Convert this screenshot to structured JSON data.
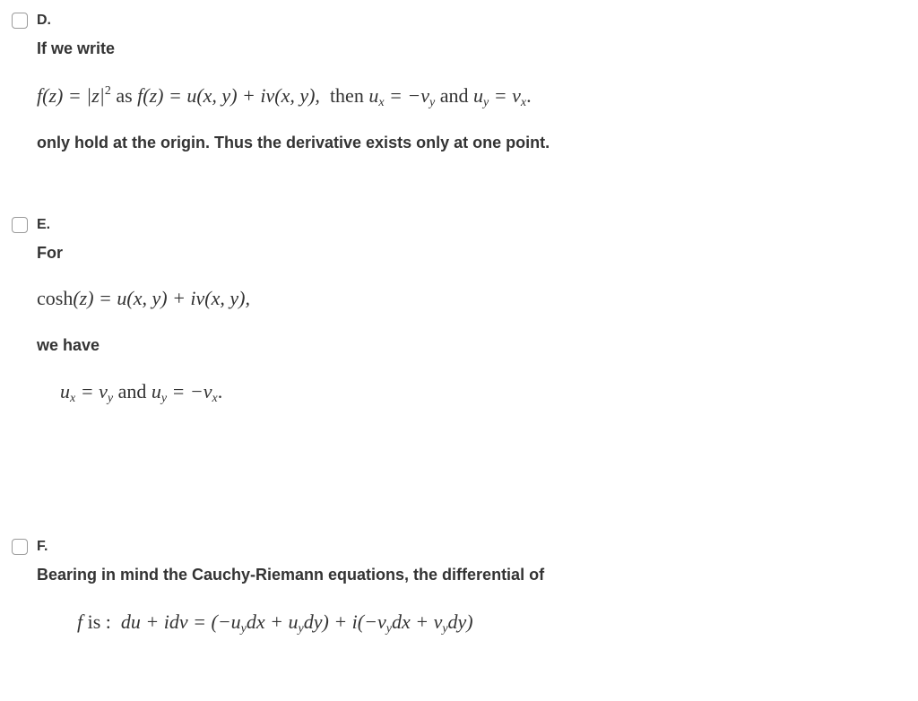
{
  "options": [
    {
      "label": "D.",
      "intro": "If we write",
      "math": {
        "lhs": "f(z) = |z|",
        "sup": "2",
        "as": "as",
        "expr": "f(z) = u(x, y) + iv(x, y),",
        "then": "then",
        "eq1_a": "u",
        "eq1_a_sub": "x",
        "eq1_op": "= −v",
        "eq1_b_sub": "y",
        "and": "and",
        "eq2_a": "u",
        "eq2_a_sub": "y",
        "eq2_op": "= v",
        "eq2_b_sub": "x",
        "end": "."
      },
      "conclusion": "only hold at the origin. Thus the derivative exists only at one point."
    },
    {
      "label": "E.",
      "intro": "For",
      "math1": {
        "fn": "cosh",
        "rest": "(z) = u(x, y) + iv(x, y),"
      },
      "middle": "we have",
      "math2": {
        "a": "u",
        "a_sub": "x",
        "op1": "= v",
        "b_sub": "y",
        "and": "and",
        "c": "u",
        "c_sub": "y",
        "op2": "= −v",
        "d_sub": "x",
        "end": "."
      }
    },
    {
      "label": "F.",
      "intro": "Bearing in mind the Cauchy-Riemann equations,  the differential of",
      "math": {
        "f": "f",
        "is": "is :",
        "p1": "du + idv = (−u",
        "s1": "y",
        "p2": "dx + u",
        "s2": "y",
        "p3": "dy) + i(−v",
        "s3": "y",
        "p4": "dx + v",
        "s4": "y",
        "p5": "dy)"
      }
    }
  ]
}
